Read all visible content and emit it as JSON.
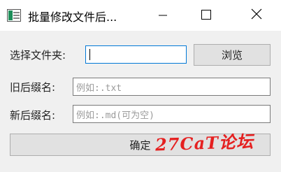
{
  "window": {
    "title": "批量修改文件后...",
    "controls": {
      "minimize": "minimize",
      "maximize": "maximize",
      "close": "close"
    }
  },
  "form": {
    "folder_label": "选择文件夹:",
    "folder_value": "",
    "browse_label": "浏览",
    "old_suffix_label": "旧后缀名:",
    "old_suffix_placeholder": "例如:.txt",
    "new_suffix_label": "新后缀名:",
    "new_suffix_placeholder": "例如:.md(可为空)",
    "confirm_label": "确定"
  },
  "watermark": {
    "text": "27CaT论坛",
    "color": "#e52020"
  }
}
